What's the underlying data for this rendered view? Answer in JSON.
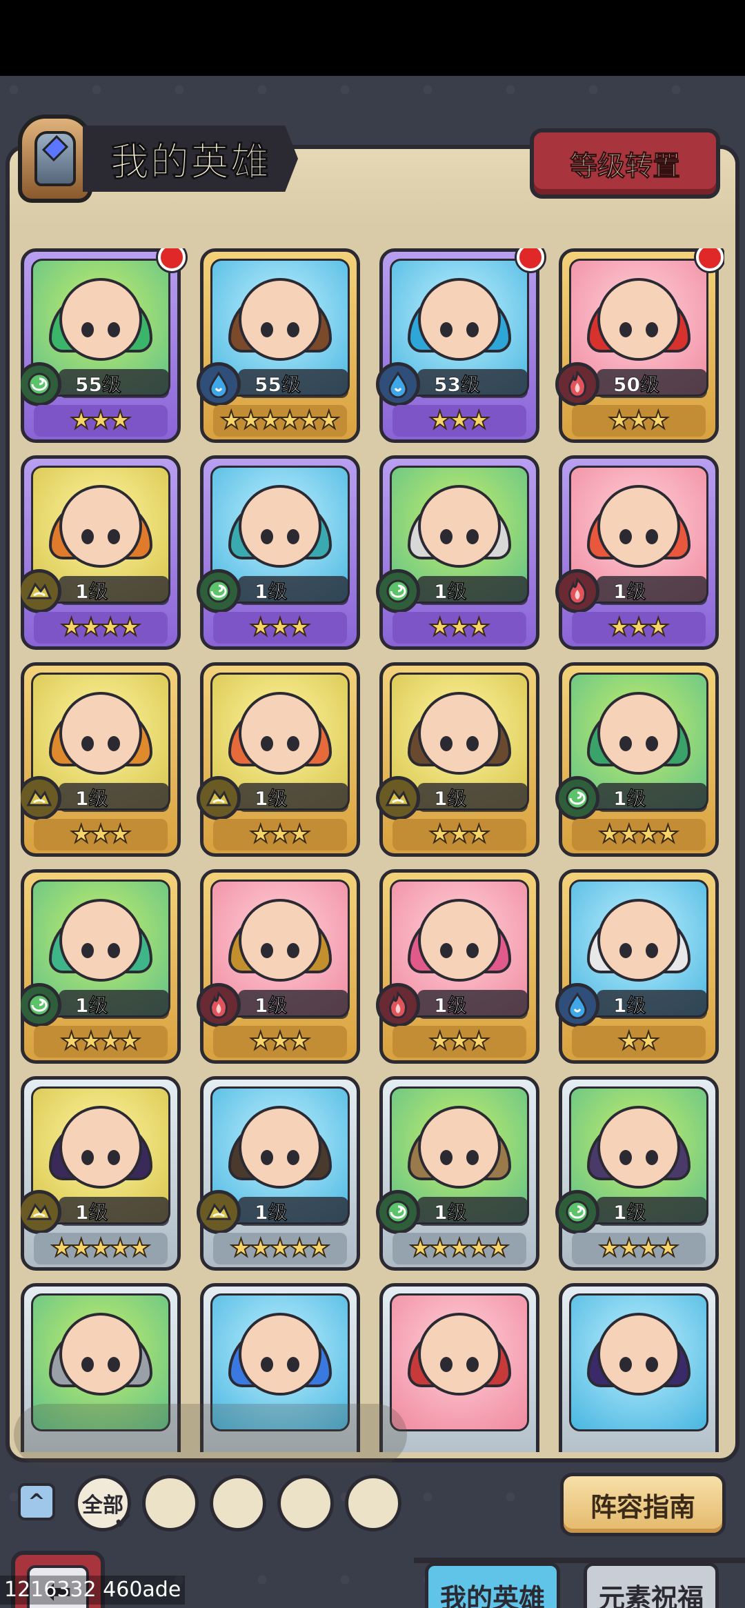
{
  "header": {
    "title": "我的英雄",
    "level_transfer_label": "等级转置"
  },
  "colors": {
    "earth": "#d8c24a",
    "water": "#3fa7e8",
    "fire": "#e2545b",
    "wind": "#5cc36a"
  },
  "heroes": [
    {
      "level": "55级",
      "element": "wind",
      "frame": "purple",
      "bg": "green",
      "stars": 3,
      "alert": true,
      "hair": "#3bb56a"
    },
    {
      "level": "55级",
      "element": "water",
      "frame": "gold",
      "bg": "blue",
      "stars": 6,
      "alert": false,
      "hair": "#7a4a2a"
    },
    {
      "level": "53级",
      "element": "water",
      "frame": "purple",
      "bg": "blue",
      "stars": 3,
      "alert": true,
      "hair": "#2fa6d8"
    },
    {
      "level": "50级",
      "element": "fire",
      "frame": "gold",
      "bg": "pink",
      "stars": 3,
      "alert": true,
      "hair": "#d8322e"
    },
    {
      "level": "1级",
      "element": "earth",
      "frame": "purple",
      "bg": "yellow",
      "stars": 4,
      "alert": false,
      "hair": "#e07b2c"
    },
    {
      "level": "1级",
      "element": "wind",
      "frame": "purple",
      "bg": "blue",
      "stars": 3,
      "alert": false,
      "hair": "#3aa9b0"
    },
    {
      "level": "1级",
      "element": "wind",
      "frame": "purple",
      "bg": "green",
      "stars": 3,
      "alert": false,
      "hair": "#d8d8d8"
    },
    {
      "level": "1级",
      "element": "fire",
      "frame": "purple",
      "bg": "pink",
      "stars": 3,
      "alert": false,
      "hair": "#e9573c"
    },
    {
      "level": "1级",
      "element": "earth",
      "frame": "gold",
      "bg": "yellow",
      "stars": 3,
      "alert": false,
      "hair": "#e08a2e"
    },
    {
      "level": "1级",
      "element": "earth",
      "frame": "gold",
      "bg": "yellow",
      "stars": 3,
      "alert": false,
      "hair": "#e66a3a"
    },
    {
      "level": "1级",
      "element": "earth",
      "frame": "gold",
      "bg": "yellow",
      "stars": 3,
      "alert": false,
      "hair": "#6a4a2e"
    },
    {
      "level": "1级",
      "element": "wind",
      "frame": "gold",
      "bg": "green",
      "stars": 4,
      "alert": false,
      "hair": "#3aa36a"
    },
    {
      "level": "1级",
      "element": "wind",
      "frame": "gold",
      "bg": "green",
      "stars": 4,
      "alert": false,
      "hair": "#3fb58a"
    },
    {
      "level": "1级",
      "element": "fire",
      "frame": "gold",
      "bg": "pink",
      "stars": 3,
      "alert": false,
      "hair": "#c4902e"
    },
    {
      "level": "1级",
      "element": "fire",
      "frame": "gold",
      "bg": "pink",
      "stars": 3,
      "alert": false,
      "hair": "#e05a8a"
    },
    {
      "level": "1级",
      "element": "water",
      "frame": "gold",
      "bg": "blue",
      "stars": 2,
      "alert": false,
      "hair": "#e8e8e8"
    },
    {
      "level": "1级",
      "element": "earth",
      "frame": "silver",
      "bg": "yellow",
      "stars": 5,
      "alert": false,
      "hair": "#3a2a5a"
    },
    {
      "level": "1级",
      "element": "earth",
      "frame": "silver",
      "bg": "blue",
      "stars": 5,
      "alert": false,
      "hair": "#4a3a2e"
    },
    {
      "level": "1级",
      "element": "wind",
      "frame": "silver",
      "bg": "green",
      "stars": 5,
      "alert": false,
      "hair": "#9a7a4a"
    },
    {
      "level": "1级",
      "element": "wind",
      "frame": "silver",
      "bg": "green",
      "stars": 4,
      "alert": false,
      "hair": "#4a3a6a"
    },
    {
      "level": "",
      "element": "",
      "frame": "silver",
      "bg": "green",
      "stars": 0,
      "alert": false,
      "hair": "#9aa0a8"
    },
    {
      "level": "",
      "element": "",
      "frame": "silver",
      "bg": "blue",
      "stars": 0,
      "alert": false,
      "hair": "#3a7ae0"
    },
    {
      "level": "",
      "element": "",
      "frame": "silver",
      "bg": "pink",
      "stars": 0,
      "alert": false,
      "hair": "#c83a3a"
    },
    {
      "level": "",
      "element": "",
      "frame": "silver",
      "bg": "blue",
      "stars": 0,
      "alert": false,
      "hair": "#3a2a6a"
    }
  ],
  "filters": {
    "all_label": "全部",
    "items": [
      "earth",
      "water",
      "fire",
      "wind"
    ]
  },
  "guide_label": "阵容指南",
  "tabs": {
    "my_heroes": "我的英雄",
    "element_blessing": "元素祝福"
  },
  "watermark": "1216332 460ade"
}
